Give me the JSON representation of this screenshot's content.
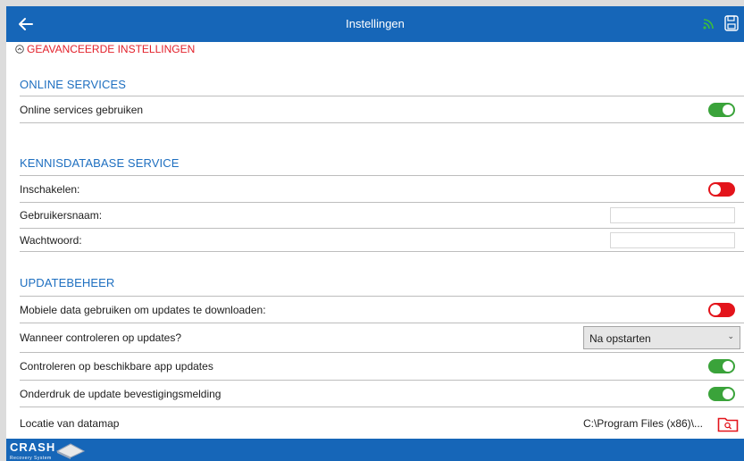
{
  "header": {
    "title": "Instellingen"
  },
  "advanced_link": {
    "label": "GEAVANCEERDE INSTELLINGEN"
  },
  "sections": {
    "online": {
      "title": "ONLINE SERVICES",
      "use_label": "Online services gebruiken",
      "use_state": "on"
    },
    "kennis": {
      "title": "KENNISDATABASE SERVICE",
      "enable_label": "Inschakelen:",
      "enable_state": "off",
      "username_label": "Gebruikersnaam:",
      "username_value": "",
      "password_label": "Wachtwoord:",
      "password_value": ""
    },
    "update": {
      "title": "UPDATEBEHEER",
      "mobile_label": "Mobiele data gebruiken om updates te downloaden:",
      "mobile_state": "off",
      "when_label": "Wanneer controleren op updates?",
      "when_value": "Na opstarten",
      "app_updates_label": "Controleren op beschikbare app updates",
      "app_updates_state": "on",
      "suppress_label": "Onderdruk de update bevestigingsmelding",
      "suppress_state": "on",
      "location_label": "Locatie van datamap",
      "location_value": "C:\\Program Files (x86)\\..."
    }
  },
  "footer": {
    "logo_text": "CRASH",
    "logo_sub": "Recovery System"
  },
  "colors": {
    "brand_blue": "#1666b8",
    "section_title": "#1e6fc0",
    "toggle_on": "#3aa33a",
    "toggle_off": "#e3141b",
    "advanced_link": "#e3212b"
  },
  "icons": {
    "back": "arrow-left-icon",
    "connection": "wifi-signal-icon",
    "save": "save-icon",
    "advanced": "chevron-up-circle-icon",
    "folder": "folder-search-icon",
    "logo": "crash-logo"
  }
}
